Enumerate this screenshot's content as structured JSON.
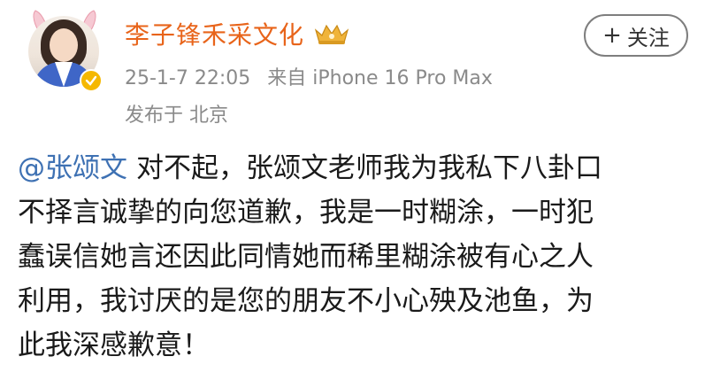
{
  "post": {
    "author": {
      "name": "李子锋禾采文化",
      "avatar_icon": "avatar",
      "badge_icon": "verified-badge-icon",
      "level_icon": "crown-icon",
      "name_color": "#e8641a"
    },
    "follow_button": {
      "plus": "+",
      "label": "关注"
    },
    "timestamp": "25-1-7 22:05",
    "source": "来自 iPhone 16 Pro Max",
    "location": "发布于 北京",
    "mention": "@张颂文",
    "text": "对不起，张颂文老师我为我私下八卦口\n不择言诚挚的向您道歉，我是一时糊涂，一时犯\n蠢误信她言还因此同情她而稀里糊涂被有心之人\n利用，我讨厌的是您的朋友不小心殃及池鱼，为\n此我深感歉意！",
    "mention_color": "#3e71b3"
  }
}
